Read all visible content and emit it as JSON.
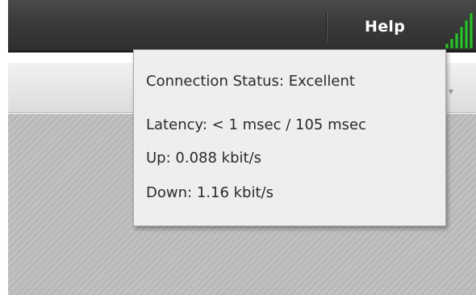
{
  "menubar": {
    "help_label": "Help",
    "signal_icon": "signal-strength-icon",
    "signal_color": "#2fbf2f"
  },
  "toolbar": {
    "chevron_icon": "chevron-down-icon"
  },
  "connection_popup": {
    "status_label": "Connection Status:",
    "status_value": "Excellent",
    "latency_label": "Latency:",
    "latency_value": "< 1 msec / 105 msec",
    "up_label": "Up:",
    "up_value": "0.088 kbit/s",
    "down_label": "Down:",
    "down_value": "1.16 kbit/s"
  }
}
